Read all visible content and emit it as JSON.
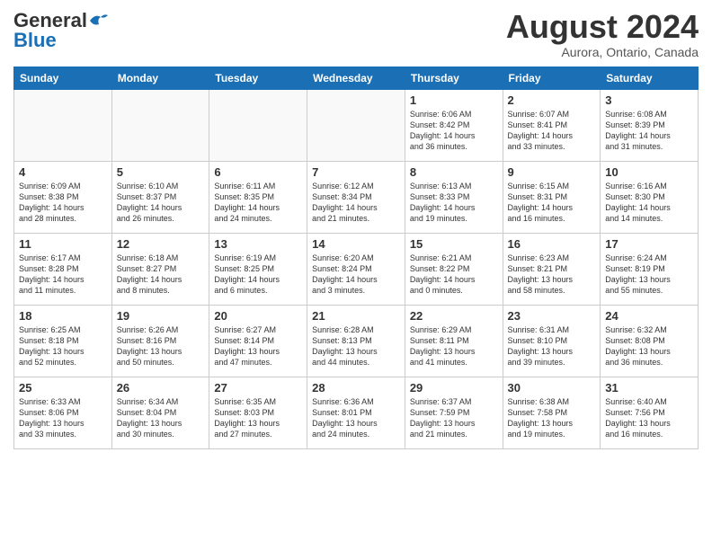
{
  "header": {
    "logo_general": "General",
    "logo_blue": "Blue",
    "month_year": "August 2024",
    "location": "Aurora, Ontario, Canada"
  },
  "weekdays": [
    "Sunday",
    "Monday",
    "Tuesday",
    "Wednesday",
    "Thursday",
    "Friday",
    "Saturday"
  ],
  "weeks": [
    [
      {
        "day": "",
        "info": ""
      },
      {
        "day": "",
        "info": ""
      },
      {
        "day": "",
        "info": ""
      },
      {
        "day": "",
        "info": ""
      },
      {
        "day": "1",
        "info": "Sunrise: 6:06 AM\nSunset: 8:42 PM\nDaylight: 14 hours\nand 36 minutes."
      },
      {
        "day": "2",
        "info": "Sunrise: 6:07 AM\nSunset: 8:41 PM\nDaylight: 14 hours\nand 33 minutes."
      },
      {
        "day": "3",
        "info": "Sunrise: 6:08 AM\nSunset: 8:39 PM\nDaylight: 14 hours\nand 31 minutes."
      }
    ],
    [
      {
        "day": "4",
        "info": "Sunrise: 6:09 AM\nSunset: 8:38 PM\nDaylight: 14 hours\nand 28 minutes."
      },
      {
        "day": "5",
        "info": "Sunrise: 6:10 AM\nSunset: 8:37 PM\nDaylight: 14 hours\nand 26 minutes."
      },
      {
        "day": "6",
        "info": "Sunrise: 6:11 AM\nSunset: 8:35 PM\nDaylight: 14 hours\nand 24 minutes."
      },
      {
        "day": "7",
        "info": "Sunrise: 6:12 AM\nSunset: 8:34 PM\nDaylight: 14 hours\nand 21 minutes."
      },
      {
        "day": "8",
        "info": "Sunrise: 6:13 AM\nSunset: 8:33 PM\nDaylight: 14 hours\nand 19 minutes."
      },
      {
        "day": "9",
        "info": "Sunrise: 6:15 AM\nSunset: 8:31 PM\nDaylight: 14 hours\nand 16 minutes."
      },
      {
        "day": "10",
        "info": "Sunrise: 6:16 AM\nSunset: 8:30 PM\nDaylight: 14 hours\nand 14 minutes."
      }
    ],
    [
      {
        "day": "11",
        "info": "Sunrise: 6:17 AM\nSunset: 8:28 PM\nDaylight: 14 hours\nand 11 minutes."
      },
      {
        "day": "12",
        "info": "Sunrise: 6:18 AM\nSunset: 8:27 PM\nDaylight: 14 hours\nand 8 minutes."
      },
      {
        "day": "13",
        "info": "Sunrise: 6:19 AM\nSunset: 8:25 PM\nDaylight: 14 hours\nand 6 minutes."
      },
      {
        "day": "14",
        "info": "Sunrise: 6:20 AM\nSunset: 8:24 PM\nDaylight: 14 hours\nand 3 minutes."
      },
      {
        "day": "15",
        "info": "Sunrise: 6:21 AM\nSunset: 8:22 PM\nDaylight: 14 hours\nand 0 minutes."
      },
      {
        "day": "16",
        "info": "Sunrise: 6:23 AM\nSunset: 8:21 PM\nDaylight: 13 hours\nand 58 minutes."
      },
      {
        "day": "17",
        "info": "Sunrise: 6:24 AM\nSunset: 8:19 PM\nDaylight: 13 hours\nand 55 minutes."
      }
    ],
    [
      {
        "day": "18",
        "info": "Sunrise: 6:25 AM\nSunset: 8:18 PM\nDaylight: 13 hours\nand 52 minutes."
      },
      {
        "day": "19",
        "info": "Sunrise: 6:26 AM\nSunset: 8:16 PM\nDaylight: 13 hours\nand 50 minutes."
      },
      {
        "day": "20",
        "info": "Sunrise: 6:27 AM\nSunset: 8:14 PM\nDaylight: 13 hours\nand 47 minutes."
      },
      {
        "day": "21",
        "info": "Sunrise: 6:28 AM\nSunset: 8:13 PM\nDaylight: 13 hours\nand 44 minutes."
      },
      {
        "day": "22",
        "info": "Sunrise: 6:29 AM\nSunset: 8:11 PM\nDaylight: 13 hours\nand 41 minutes."
      },
      {
        "day": "23",
        "info": "Sunrise: 6:31 AM\nSunset: 8:10 PM\nDaylight: 13 hours\nand 39 minutes."
      },
      {
        "day": "24",
        "info": "Sunrise: 6:32 AM\nSunset: 8:08 PM\nDaylight: 13 hours\nand 36 minutes."
      }
    ],
    [
      {
        "day": "25",
        "info": "Sunrise: 6:33 AM\nSunset: 8:06 PM\nDaylight: 13 hours\nand 33 minutes."
      },
      {
        "day": "26",
        "info": "Sunrise: 6:34 AM\nSunset: 8:04 PM\nDaylight: 13 hours\nand 30 minutes."
      },
      {
        "day": "27",
        "info": "Sunrise: 6:35 AM\nSunset: 8:03 PM\nDaylight: 13 hours\nand 27 minutes."
      },
      {
        "day": "28",
        "info": "Sunrise: 6:36 AM\nSunset: 8:01 PM\nDaylight: 13 hours\nand 24 minutes."
      },
      {
        "day": "29",
        "info": "Sunrise: 6:37 AM\nSunset: 7:59 PM\nDaylight: 13 hours\nand 21 minutes."
      },
      {
        "day": "30",
        "info": "Sunrise: 6:38 AM\nSunset: 7:58 PM\nDaylight: 13 hours\nand 19 minutes."
      },
      {
        "day": "31",
        "info": "Sunrise: 6:40 AM\nSunset: 7:56 PM\nDaylight: 13 hours\nand 16 minutes."
      }
    ]
  ]
}
